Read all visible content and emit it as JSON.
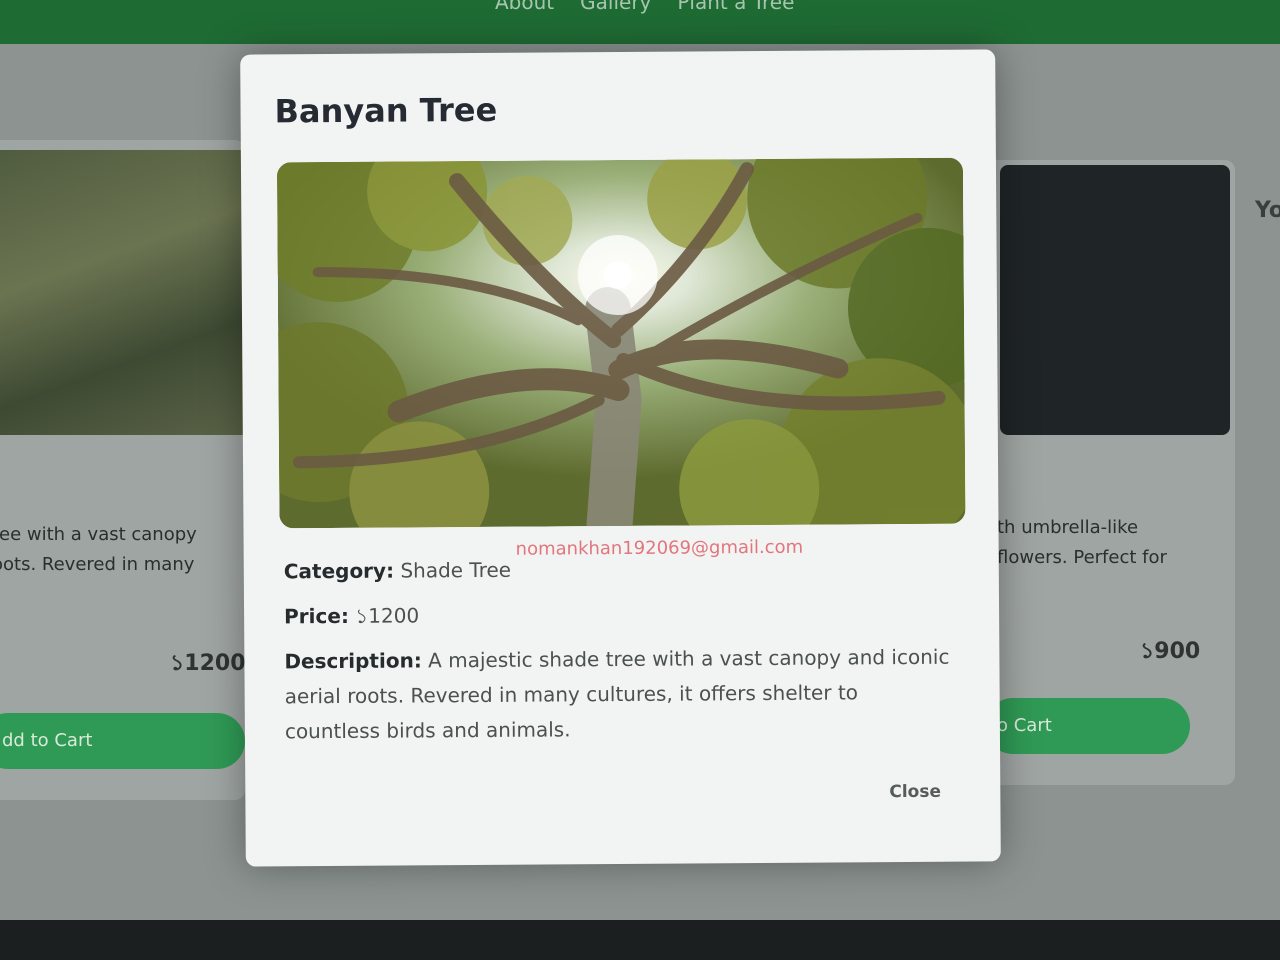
{
  "nav": {
    "links": [
      "About",
      "Gallery",
      "Plant a Tree"
    ]
  },
  "background_cards": {
    "left": {
      "description_line1": "ree with a vast canopy",
      "description_line2": "oots. Revered in many",
      "price": "১1200",
      "button_label": "dd to Cart"
    },
    "right": {
      "description_line1": "th umbrella-like",
      "description_line2": "flowers. Perfect for",
      "price": "১900",
      "button_label": "o Cart"
    },
    "side_hint": "Yo"
  },
  "modal": {
    "title": "Banyan Tree",
    "watermark": "nomankhan192069@gmail.com",
    "category_label": "Category:",
    "category_value": "Shade Tree",
    "price_label": "Price:",
    "price_value": "১1200",
    "description_label": "Description:",
    "description_value": "A majestic shade tree with a vast canopy and iconic aerial roots. Revered in many cultures, it offers shelter to countless birds and animals.",
    "close_label": "Close"
  }
}
